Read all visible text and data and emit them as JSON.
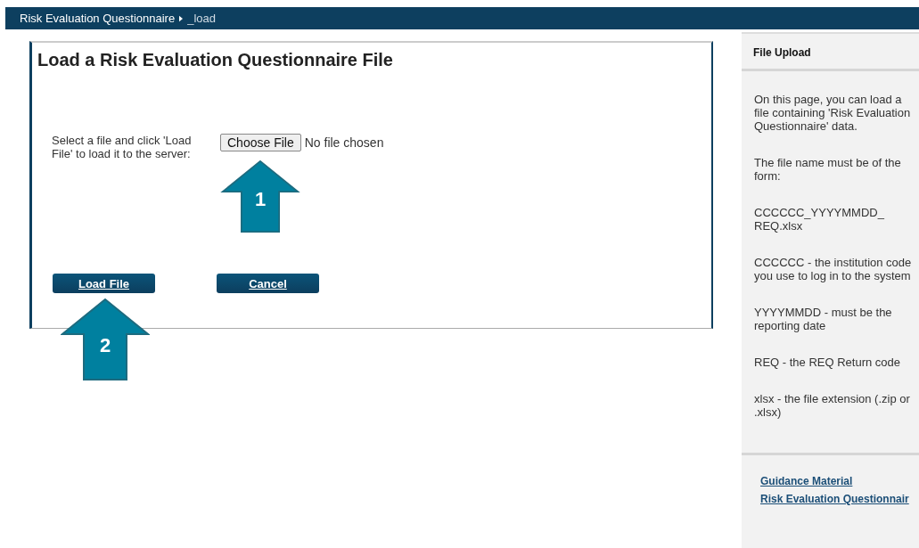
{
  "breadcrumb": {
    "items": [
      "Risk Evaluation Questionnaire",
      "_load"
    ]
  },
  "main": {
    "title": "Load a Risk Evaluation Questionnaire File",
    "instruction": "Select a file and click 'Load File' to load it to the server:",
    "file_input": {
      "button": "Choose File",
      "status": "No file chosen"
    },
    "buttons": [
      "Load File",
      "Cancel"
    ],
    "callouts": [
      {
        "number": "1",
        "kind": "file"
      },
      {
        "number": "2",
        "kind": "load"
      }
    ]
  },
  "sidebar": {
    "title": "File Upload",
    "paragraphs": [
      "On this page, you can load a file containing 'Risk Evaluation Questionnaire' data.",
      "The file name must be of the form:",
      "CCCCCC_YYYYMMDD_ REQ.xlsx",
      "CCCCCC - the institution code you use to log in to the system",
      "YYYYMMDD - must be the reporting date",
      "REQ - the REQ Return code",
      "xlsx - the file extension (.zip or .xlsx)"
    ],
    "links": [
      "Guidance Material",
      "Risk Evaluation Questionnair"
    ]
  }
}
